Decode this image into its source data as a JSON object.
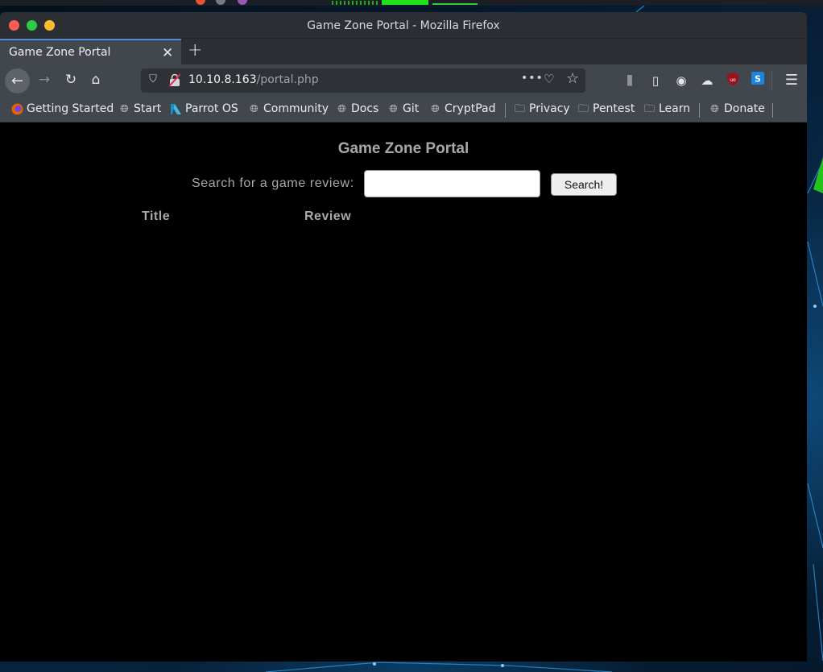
{
  "window": {
    "title": "Game Zone Portal - Mozilla Firefox"
  },
  "tabs": [
    {
      "label": "Game Zone Portal",
      "active": true
    }
  ],
  "navigation": {
    "url_host": "10.10.8.163",
    "url_path": "/portal.php"
  },
  "bookmarks": [
    {
      "label": "Getting Started",
      "icon": "firefox-icon"
    },
    {
      "label": "Start",
      "icon": "globe-icon"
    },
    {
      "label": "Parrot OS",
      "icon": "parrot-icon"
    },
    {
      "label": "Community",
      "icon": "globe-icon"
    },
    {
      "label": "Docs",
      "icon": "globe-icon"
    },
    {
      "label": "Git",
      "icon": "globe-icon"
    },
    {
      "label": "CryptPad",
      "icon": "globe-icon"
    },
    {
      "label": "Privacy",
      "icon": "folder-icon"
    },
    {
      "label": "Pentest",
      "icon": "folder-icon"
    },
    {
      "label": "Learn",
      "icon": "folder-icon"
    },
    {
      "label": "Donate",
      "icon": "globe-icon"
    }
  ],
  "page": {
    "title": "Game Zone Portal",
    "search_label": "Search for a game review:",
    "search_value": "",
    "search_button": "Search!",
    "columns": [
      "Title",
      "Review"
    ]
  },
  "colors": {
    "page_background": "#000000",
    "page_text": "#a8a8a8",
    "toolbar": "#42464d",
    "titlebar": "#2b2e33"
  }
}
